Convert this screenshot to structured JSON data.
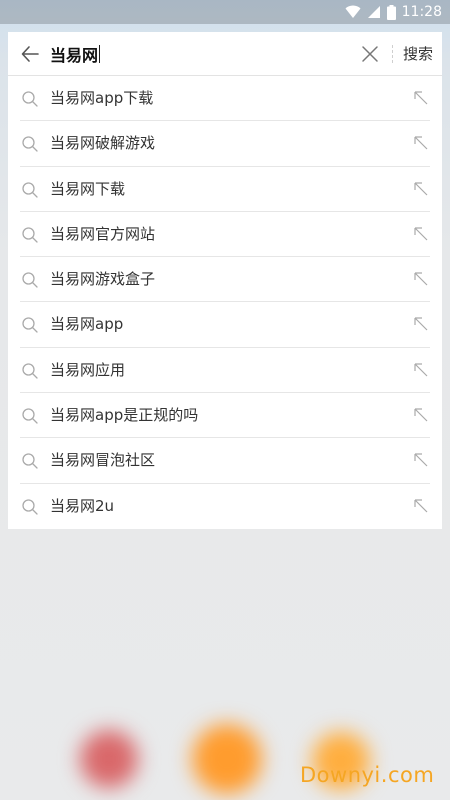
{
  "status_bar": {
    "time": "11:28",
    "wifi_icon": "wifi-icon",
    "signal_icon": "signal-icon",
    "battery_icon": "battery-icon"
  },
  "search": {
    "back_icon": "arrow-left-icon",
    "query": "当易网",
    "clear_icon": "close-icon",
    "submit_label": "搜索"
  },
  "suggestions": [
    {
      "text": "当易网app下载",
      "icon": "search-icon",
      "fill_icon": "arrow-up-left-icon"
    },
    {
      "text": "当易网破解游戏",
      "icon": "search-icon",
      "fill_icon": "arrow-up-left-icon"
    },
    {
      "text": "当易网下载",
      "icon": "search-icon",
      "fill_icon": "arrow-up-left-icon"
    },
    {
      "text": "当易网官方网站",
      "icon": "search-icon",
      "fill_icon": "arrow-up-left-icon"
    },
    {
      "text": "当易网游戏盒子",
      "icon": "search-icon",
      "fill_icon": "arrow-up-left-icon"
    },
    {
      "text": "当易网app",
      "icon": "search-icon",
      "fill_icon": "arrow-up-left-icon"
    },
    {
      "text": "当易网应用",
      "icon": "search-icon",
      "fill_icon": "arrow-up-left-icon"
    },
    {
      "text": "当易网app是正规的吗",
      "icon": "search-icon",
      "fill_icon": "arrow-up-left-icon"
    },
    {
      "text": "当易网冒泡社区",
      "icon": "search-icon",
      "fill_icon": "arrow-up-left-icon"
    },
    {
      "text": "当易网2u",
      "icon": "search-icon",
      "fill_icon": "arrow-up-left-icon"
    }
  ],
  "watermark": "Downyi.com",
  "colors": {
    "watermark": "#f5a623",
    "list_background": "#ffffff",
    "text": "#333333"
  }
}
